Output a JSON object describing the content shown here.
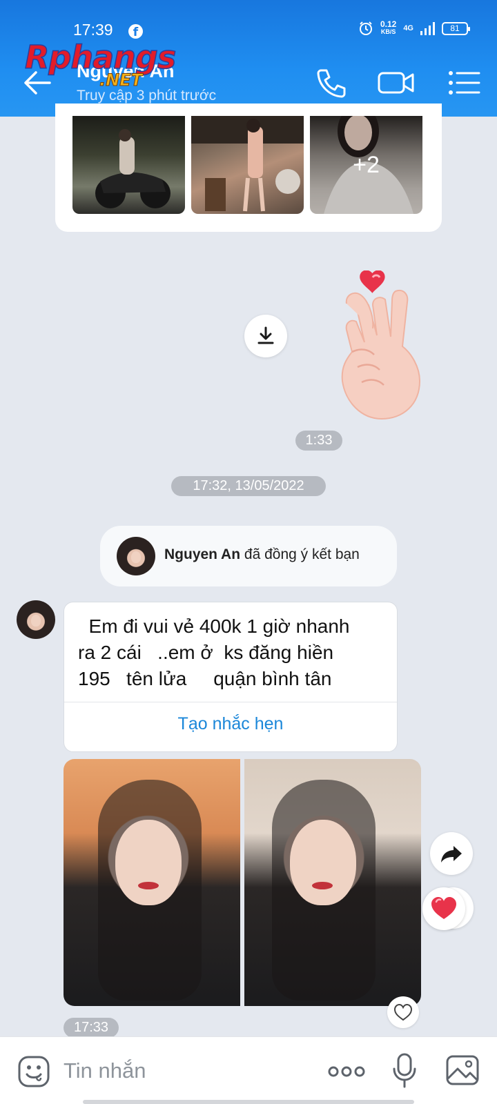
{
  "status_bar": {
    "time": "17:39",
    "app_icon": "facebook-icon",
    "net_speed": "0.12",
    "net_unit": "KB/S",
    "network_type": "4G",
    "battery": "81"
  },
  "header": {
    "contact_name": "Nguyen An",
    "last_seen": "Truy cập 3 phút trước",
    "watermark_main": "Rphangs",
    "watermark_sub": ".NET",
    "icons": [
      "back-arrow-icon",
      "phone-icon",
      "video-call-icon",
      "menu-list-icon"
    ]
  },
  "top_album": {
    "more_count": "+2"
  },
  "sticker": {
    "icon": "finger-heart-sticker",
    "time": "1:33"
  },
  "date_separator": "17:32, 13/05/2022",
  "friend_notice": {
    "name": "Nguyen An",
    "text": " đã đồng ý kết bạn"
  },
  "message": {
    "lines": "  Em đi vui vẻ 400k 1 giờ nhanh\nra 2 cái   ..em ở  ks đăng hiền\n195   tên lửa     quận bình tân",
    "reminder_label": "Tạo nhắc hẹn"
  },
  "photo_message": {
    "time": "17:33"
  },
  "input_bar": {
    "placeholder": "Tin nhắn",
    "icons": [
      "emoji-icon",
      "more-options-icon",
      "microphone-icon",
      "gallery-icon"
    ]
  },
  "colors": {
    "header_blue": "#1f8ef1",
    "chat_bg": "#e4e8ef",
    "link_blue": "#1b87d9",
    "heart_red": "#e8334a"
  }
}
